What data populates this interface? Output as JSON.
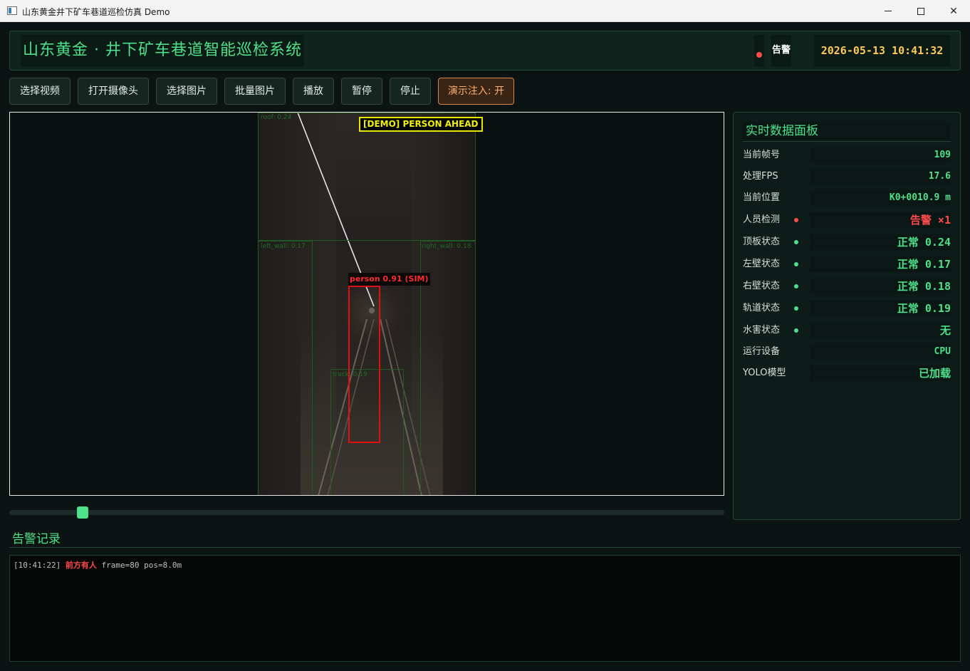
{
  "window": {
    "title": "山东黄金井下矿车巷道巡检仿真 Demo"
  },
  "header": {
    "title": "山东黄金 · 井下矿车巷道智能巡检系统",
    "status_text": "告警",
    "clock": "2026-05-13 10:41:32",
    "status_color": "#ff4b4b"
  },
  "toolbar": {
    "buttons": [
      "选择视频",
      "打开摄像头",
      "选择图片",
      "批量图片",
      "播放",
      "暂停",
      "停止",
      "演示注入: 开"
    ]
  },
  "video": {
    "banner": "[DEMO] PERSON AHEAD",
    "person_label": "person 0.91 (SIM)",
    "zones": {
      "roof": "roof: 0.24",
      "left_wall": "left_wall: 0.17",
      "right_wall": "right_wall: 0.18",
      "track": "track: 0.19"
    }
  },
  "playback": {
    "progress": 0.103
  },
  "panel": {
    "title": "实时数据面板",
    "rows": [
      {
        "label": "当前帧号",
        "value": "109"
      },
      {
        "label": "处理FPS",
        "value": "17.6"
      },
      {
        "label": "当前位置",
        "value": "K0+0010.9 m"
      },
      {
        "label": "人员检测",
        "value": "告警 ×1",
        "dot": "#ff4b4b"
      },
      {
        "label": "顶板状态",
        "value": "正常 0.24",
        "dot": "#4ee08a"
      },
      {
        "label": "左壁状态",
        "value": "正常 0.17",
        "dot": "#4ee08a"
      },
      {
        "label": "右壁状态",
        "value": "正常 0.18",
        "dot": "#4ee08a"
      },
      {
        "label": "轨道状态",
        "value": "正常 0.19",
        "dot": "#4ee08a"
      },
      {
        "label": "水害状态",
        "value": "无",
        "dot": "#4ee08a"
      },
      {
        "label": "运行设备",
        "value": "CPU"
      },
      {
        "label": "YOLO模型",
        "value": "已加载"
      }
    ]
  },
  "log": {
    "title": "告警记录",
    "entries": [
      {
        "time": "[10:41:22]",
        "message": "前方有人",
        "detail": "frame=80 pos=8.0m"
      }
    ]
  }
}
